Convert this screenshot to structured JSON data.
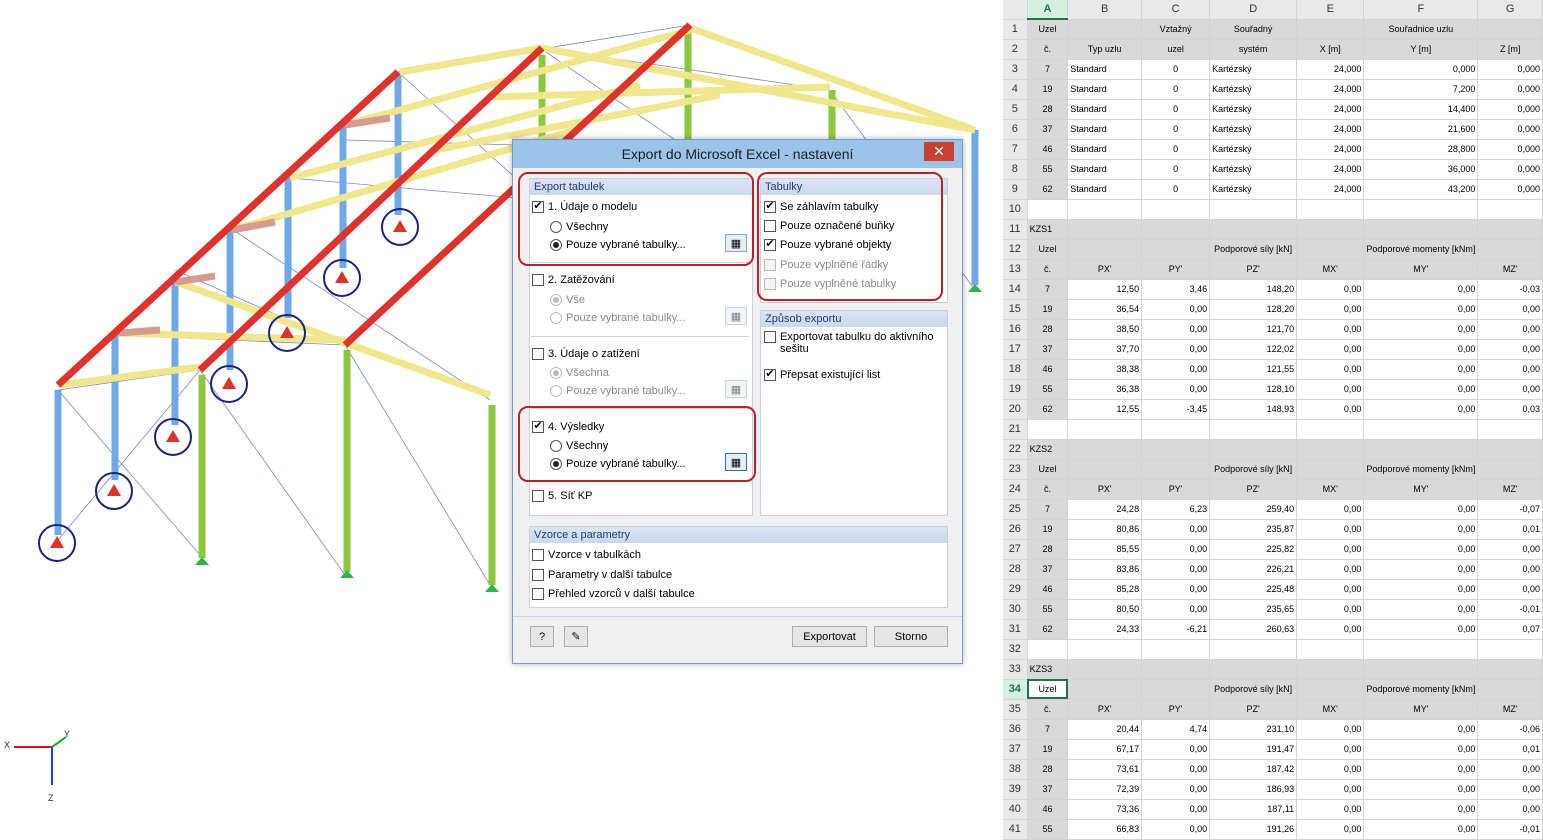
{
  "dialog": {
    "title": "Export do Microsoft Excel - nastavení",
    "close_label": "✕",
    "export_group": {
      "header": "Export tabulek",
      "model": {
        "label": "1. Údaje o modelu",
        "opt_all": "Všechny",
        "opt_selected": "Pouze vybrané tabulky..."
      },
      "loading": {
        "label": "2. Zatěžování",
        "opt_all": "Vše",
        "opt_selected": "Pouze vybrané tabulky..."
      },
      "loads": {
        "label": "3. Údaje o zatížení",
        "opt_all": "Všechna",
        "opt_selected": "Pouze vybrané tabulky..."
      },
      "results": {
        "label": "4. Výsledky",
        "opt_all": "Všechny",
        "opt_selected": "Pouze vybrané tabulky..."
      },
      "mesh": {
        "label": "5. Síť KP"
      }
    },
    "tables_group": {
      "header": "Tabulky",
      "items": [
        "Se záhlavím tabulky",
        "Pouze označené buňky",
        "Pouze vybrané objekty",
        "Pouze vyplněné řádky",
        "Pouze vyplněné tabulky"
      ]
    },
    "method_group": {
      "header": "Způsob exportu",
      "items": [
        "Exportovat tabulku do aktivního sešitu",
        "Přepsat existující list"
      ]
    },
    "formula_group": {
      "header": "Vzorce a parametry",
      "items": [
        "Vzorce v tabulkách",
        "Parametry v další tabulce",
        "Přehled vzorců v další tabulce"
      ]
    },
    "buttons": {
      "export": "Exportovat",
      "cancel": "Storno"
    }
  },
  "axes": {
    "x": "X",
    "y": "Y",
    "z": "Z"
  },
  "sheet": {
    "columns": [
      "A",
      "B",
      "C",
      "D",
      "E",
      "F",
      "G"
    ],
    "rows": [
      {
        "n": "1",
        "cells": [
          "Uzel",
          "",
          "Vztažný",
          "Souřadný",
          "",
          "Souřadnice uzlu",
          ""
        ],
        "style": "hdr"
      },
      {
        "n": "2",
        "cells": [
          "č.",
          "Typ uzlu",
          "uzel",
          "systém",
          "X [m]",
          "Y [m]",
          "Z [m]"
        ],
        "style": "hdr"
      },
      {
        "n": "3",
        "cells": [
          "7",
          "Standard",
          "0",
          "Kartézský",
          "24,000",
          "0,000",
          "0,000"
        ],
        "style": "node"
      },
      {
        "n": "4",
        "cells": [
          "19",
          "Standard",
          "0",
          "Kartézský",
          "24,000",
          "7,200",
          "0,000"
        ],
        "style": "node"
      },
      {
        "n": "5",
        "cells": [
          "28",
          "Standard",
          "0",
          "Kartézský",
          "24,000",
          "14,400",
          "0,000"
        ],
        "style": "node"
      },
      {
        "n": "6",
        "cells": [
          "37",
          "Standard",
          "0",
          "Kartézský",
          "24,000",
          "21,600",
          "0,000"
        ],
        "style": "node"
      },
      {
        "n": "7",
        "cells": [
          "46",
          "Standard",
          "0",
          "Kartézský",
          "24,000",
          "28,800",
          "0,000"
        ],
        "style": "node"
      },
      {
        "n": "8",
        "cells": [
          "55",
          "Standard",
          "0",
          "Kartézský",
          "24,000",
          "36,000",
          "0,000"
        ],
        "style": "node"
      },
      {
        "n": "9",
        "cells": [
          "62",
          "Standard",
          "0",
          "Kartézský",
          "24,000",
          "43,200",
          "0,000"
        ],
        "style": "node"
      },
      {
        "n": "10",
        "cells": [
          "",
          "",
          "",
          "",
          "",
          "",
          ""
        ],
        "style": "blank"
      },
      {
        "n": "11",
        "cells": [
          "KZS1",
          "",
          "",
          "",
          "",
          "",
          ""
        ],
        "style": "sect"
      },
      {
        "n": "12",
        "cells": [
          "Uzel",
          "",
          "",
          "Podporové síly [kN]",
          "",
          "Podporové momenty [kNm]",
          ""
        ],
        "style": "hdr"
      },
      {
        "n": "13",
        "cells": [
          "č.",
          "PX'",
          "PY'",
          "PZ'",
          "MX'",
          "MY'",
          "MZ'"
        ],
        "style": "hdr"
      },
      {
        "n": "14",
        "cells": [
          "7",
          "12,50",
          "3,46",
          "148,20",
          "0,00",
          "0,00",
          "-0,03"
        ],
        "style": "res"
      },
      {
        "n": "15",
        "cells": [
          "19",
          "36,54",
          "0,00",
          "128,20",
          "0,00",
          "0,00",
          "0,00"
        ],
        "style": "res"
      },
      {
        "n": "16",
        "cells": [
          "28",
          "38,50",
          "0,00",
          "121,70",
          "0,00",
          "0,00",
          "0,00"
        ],
        "style": "res"
      },
      {
        "n": "17",
        "cells": [
          "37",
          "37,70",
          "0,00",
          "122,02",
          "0,00",
          "0,00",
          "0,00"
        ],
        "style": "res"
      },
      {
        "n": "18",
        "cells": [
          "46",
          "38,38",
          "0,00",
          "121,55",
          "0,00",
          "0,00",
          "0,00"
        ],
        "style": "res"
      },
      {
        "n": "19",
        "cells": [
          "55",
          "36,38",
          "0,00",
          "128,10",
          "0,00",
          "0,00",
          "0,00"
        ],
        "style": "res"
      },
      {
        "n": "20",
        "cells": [
          "62",
          "12,55",
          "-3,45",
          "148,93",
          "0,00",
          "0,00",
          "0,03"
        ],
        "style": "res"
      },
      {
        "n": "21",
        "cells": [
          "",
          "",
          "",
          "",
          "",
          "",
          ""
        ],
        "style": "blank"
      },
      {
        "n": "22",
        "cells": [
          "KZS2",
          "",
          "",
          "",
          "",
          "",
          ""
        ],
        "style": "sect"
      },
      {
        "n": "23",
        "cells": [
          "Uzel",
          "",
          "",
          "Podporové síly [kN]",
          "",
          "Podporové momenty [kNm]",
          ""
        ],
        "style": "hdr"
      },
      {
        "n": "24",
        "cells": [
          "č.",
          "PX'",
          "PY'",
          "PZ'",
          "MX'",
          "MY'",
          "MZ'"
        ],
        "style": "hdr"
      },
      {
        "n": "25",
        "cells": [
          "7",
          "24,28",
          "6,23",
          "259,40",
          "0,00",
          "0,00",
          "-0,07"
        ],
        "style": "res"
      },
      {
        "n": "26",
        "cells": [
          "19",
          "80,86",
          "0,00",
          "235,87",
          "0,00",
          "0,00",
          "0,01"
        ],
        "style": "res"
      },
      {
        "n": "27",
        "cells": [
          "28",
          "85,55",
          "0,00",
          "225,82",
          "0,00",
          "0,00",
          "0,00"
        ],
        "style": "res"
      },
      {
        "n": "28",
        "cells": [
          "37",
          "83,86",
          "0,00",
          "226,21",
          "0,00",
          "0,00",
          "0,00"
        ],
        "style": "res"
      },
      {
        "n": "29",
        "cells": [
          "46",
          "85,28",
          "0,00",
          "225,48",
          "0,00",
          "0,00",
          "0,00"
        ],
        "style": "res"
      },
      {
        "n": "30",
        "cells": [
          "55",
          "80,50",
          "0,00",
          "235,65",
          "0,00",
          "0,00",
          "-0,01"
        ],
        "style": "res"
      },
      {
        "n": "31",
        "cells": [
          "62",
          "24,33",
          "-6,21",
          "260,63",
          "0,00",
          "0,00",
          "0,07"
        ],
        "style": "res"
      },
      {
        "n": "32",
        "cells": [
          "",
          "",
          "",
          "",
          "",
          "",
          ""
        ],
        "style": "blank"
      },
      {
        "n": "33",
        "cells": [
          "KZS3",
          "",
          "",
          "",
          "",
          "",
          ""
        ],
        "style": "sect"
      },
      {
        "n": "34",
        "cells": [
          "Uzel",
          "",
          "",
          "Podporové síly [kN]",
          "",
          "Podporové momenty [kNm]",
          ""
        ],
        "style": "hdr",
        "active": true
      },
      {
        "n": "35",
        "cells": [
          "č.",
          "PX'",
          "PY'",
          "PZ'",
          "MX'",
          "MY'",
          "MZ'"
        ],
        "style": "hdr"
      },
      {
        "n": "36",
        "cells": [
          "7",
          "20,44",
          "4,74",
          "231,10",
          "0,00",
          "0,00",
          "-0,06"
        ],
        "style": "res"
      },
      {
        "n": "37",
        "cells": [
          "19",
          "67,17",
          "0,00",
          "191,47",
          "0,00",
          "0,00",
          "0,01"
        ],
        "style": "res"
      },
      {
        "n": "38",
        "cells": [
          "28",
          "73,61",
          "0,00",
          "187,42",
          "0,00",
          "0,00",
          "0,00"
        ],
        "style": "res"
      },
      {
        "n": "39",
        "cells": [
          "37",
          "72,39",
          "0,00",
          "186,93",
          "0,00",
          "0,00",
          "0,00"
        ],
        "style": "res"
      },
      {
        "n": "40",
        "cells": [
          "46",
          "73,36",
          "0,00",
          "187,11",
          "0,00",
          "0,00",
          "0,00"
        ],
        "style": "res"
      },
      {
        "n": "41",
        "cells": [
          "55",
          "66,83",
          "0,00",
          "191,26",
          "0,00",
          "0,00",
          "-0,01"
        ],
        "style": "res"
      }
    ]
  }
}
